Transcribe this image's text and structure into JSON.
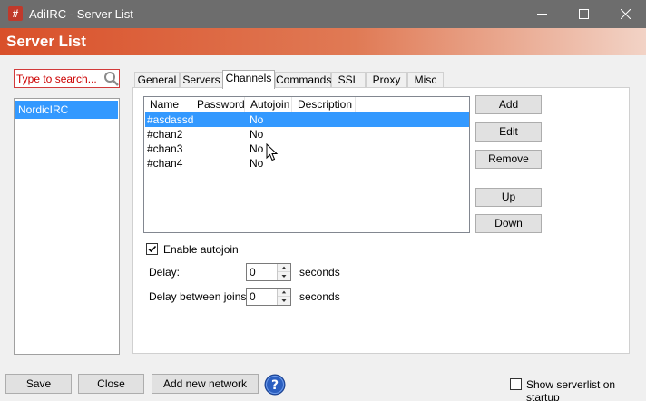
{
  "window": {
    "app_icon_glyph": "#",
    "title": "AdiIRC - Server List"
  },
  "banner": {
    "title": "Server List"
  },
  "search": {
    "placeholder": "Type to search..."
  },
  "networks": [
    {
      "label": "NordicIRC",
      "selected": true
    }
  ],
  "tabs": [
    {
      "label": "General"
    },
    {
      "label": "Servers"
    },
    {
      "label": "Channels",
      "active": true
    },
    {
      "label": "Commands"
    },
    {
      "label": "SSL"
    },
    {
      "label": "Proxy"
    },
    {
      "label": "Misc"
    }
  ],
  "channel_table": {
    "columns": [
      "Name",
      "Password",
      "Autojoin",
      "Description"
    ],
    "rows": [
      {
        "name": "#asdassd",
        "password": "",
        "autojoin": "No",
        "description": "",
        "selected": true
      },
      {
        "name": "#chan2",
        "password": "",
        "autojoin": "No",
        "description": ""
      },
      {
        "name": "#chan3",
        "password": "",
        "autojoin": "No",
        "description": ""
      },
      {
        "name": "#chan4",
        "password": "",
        "autojoin": "No",
        "description": ""
      }
    ]
  },
  "side_buttons": {
    "add": "Add",
    "edit": "Edit",
    "remove": "Remove",
    "up": "Up",
    "down": "Down"
  },
  "autojoin": {
    "label": "Enable autojoin",
    "checked": true
  },
  "delay": {
    "label": "Delay:",
    "value": "0",
    "unit": "seconds"
  },
  "delay_between_joins": {
    "label": "Delay between joins:",
    "value": "0",
    "unit": "seconds"
  },
  "footer": {
    "save": "Save",
    "close": "Close",
    "add_network": "Add new network",
    "show_on_startup": {
      "label": "Show serverlist on startup",
      "checked": false
    }
  },
  "colors": {
    "selection": "#3399ff",
    "banner": "#d9502a",
    "search_border": "#d23a3a"
  }
}
